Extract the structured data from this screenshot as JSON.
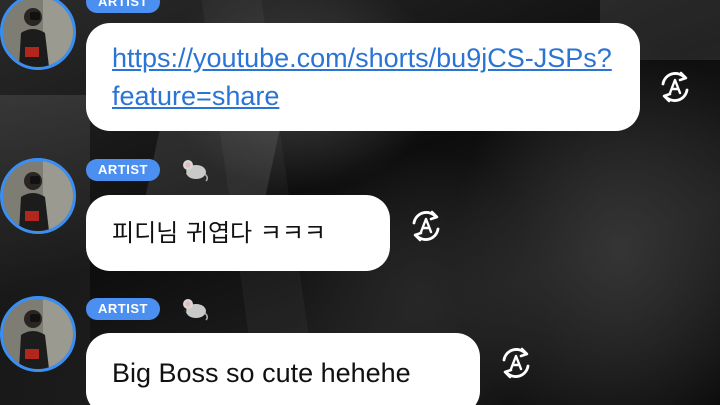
{
  "chat": {
    "messages": [
      {
        "badge": "ARTIST",
        "text": "https://youtube.com/shorts/bu9jCS-JSPs?feature=share",
        "is_link": true,
        "translate_icon": "translate-icon"
      },
      {
        "badge": "ARTIST",
        "emoji_icon": "mouse-emoji-icon",
        "text": "피디님 귀엽다 ㅋㅋㅋ",
        "translate_icon": "translate-icon"
      },
      {
        "badge": "ARTIST",
        "emoji_icon": "mouse-emoji-icon",
        "text": "Big Boss so cute hehehe",
        "translate_icon": "translate-icon"
      }
    ]
  },
  "colors": {
    "badge": "#4b8ff0",
    "avatar_ring": "#3a8ff5",
    "link": "#2a74d6",
    "bubble": "#ffffff"
  }
}
